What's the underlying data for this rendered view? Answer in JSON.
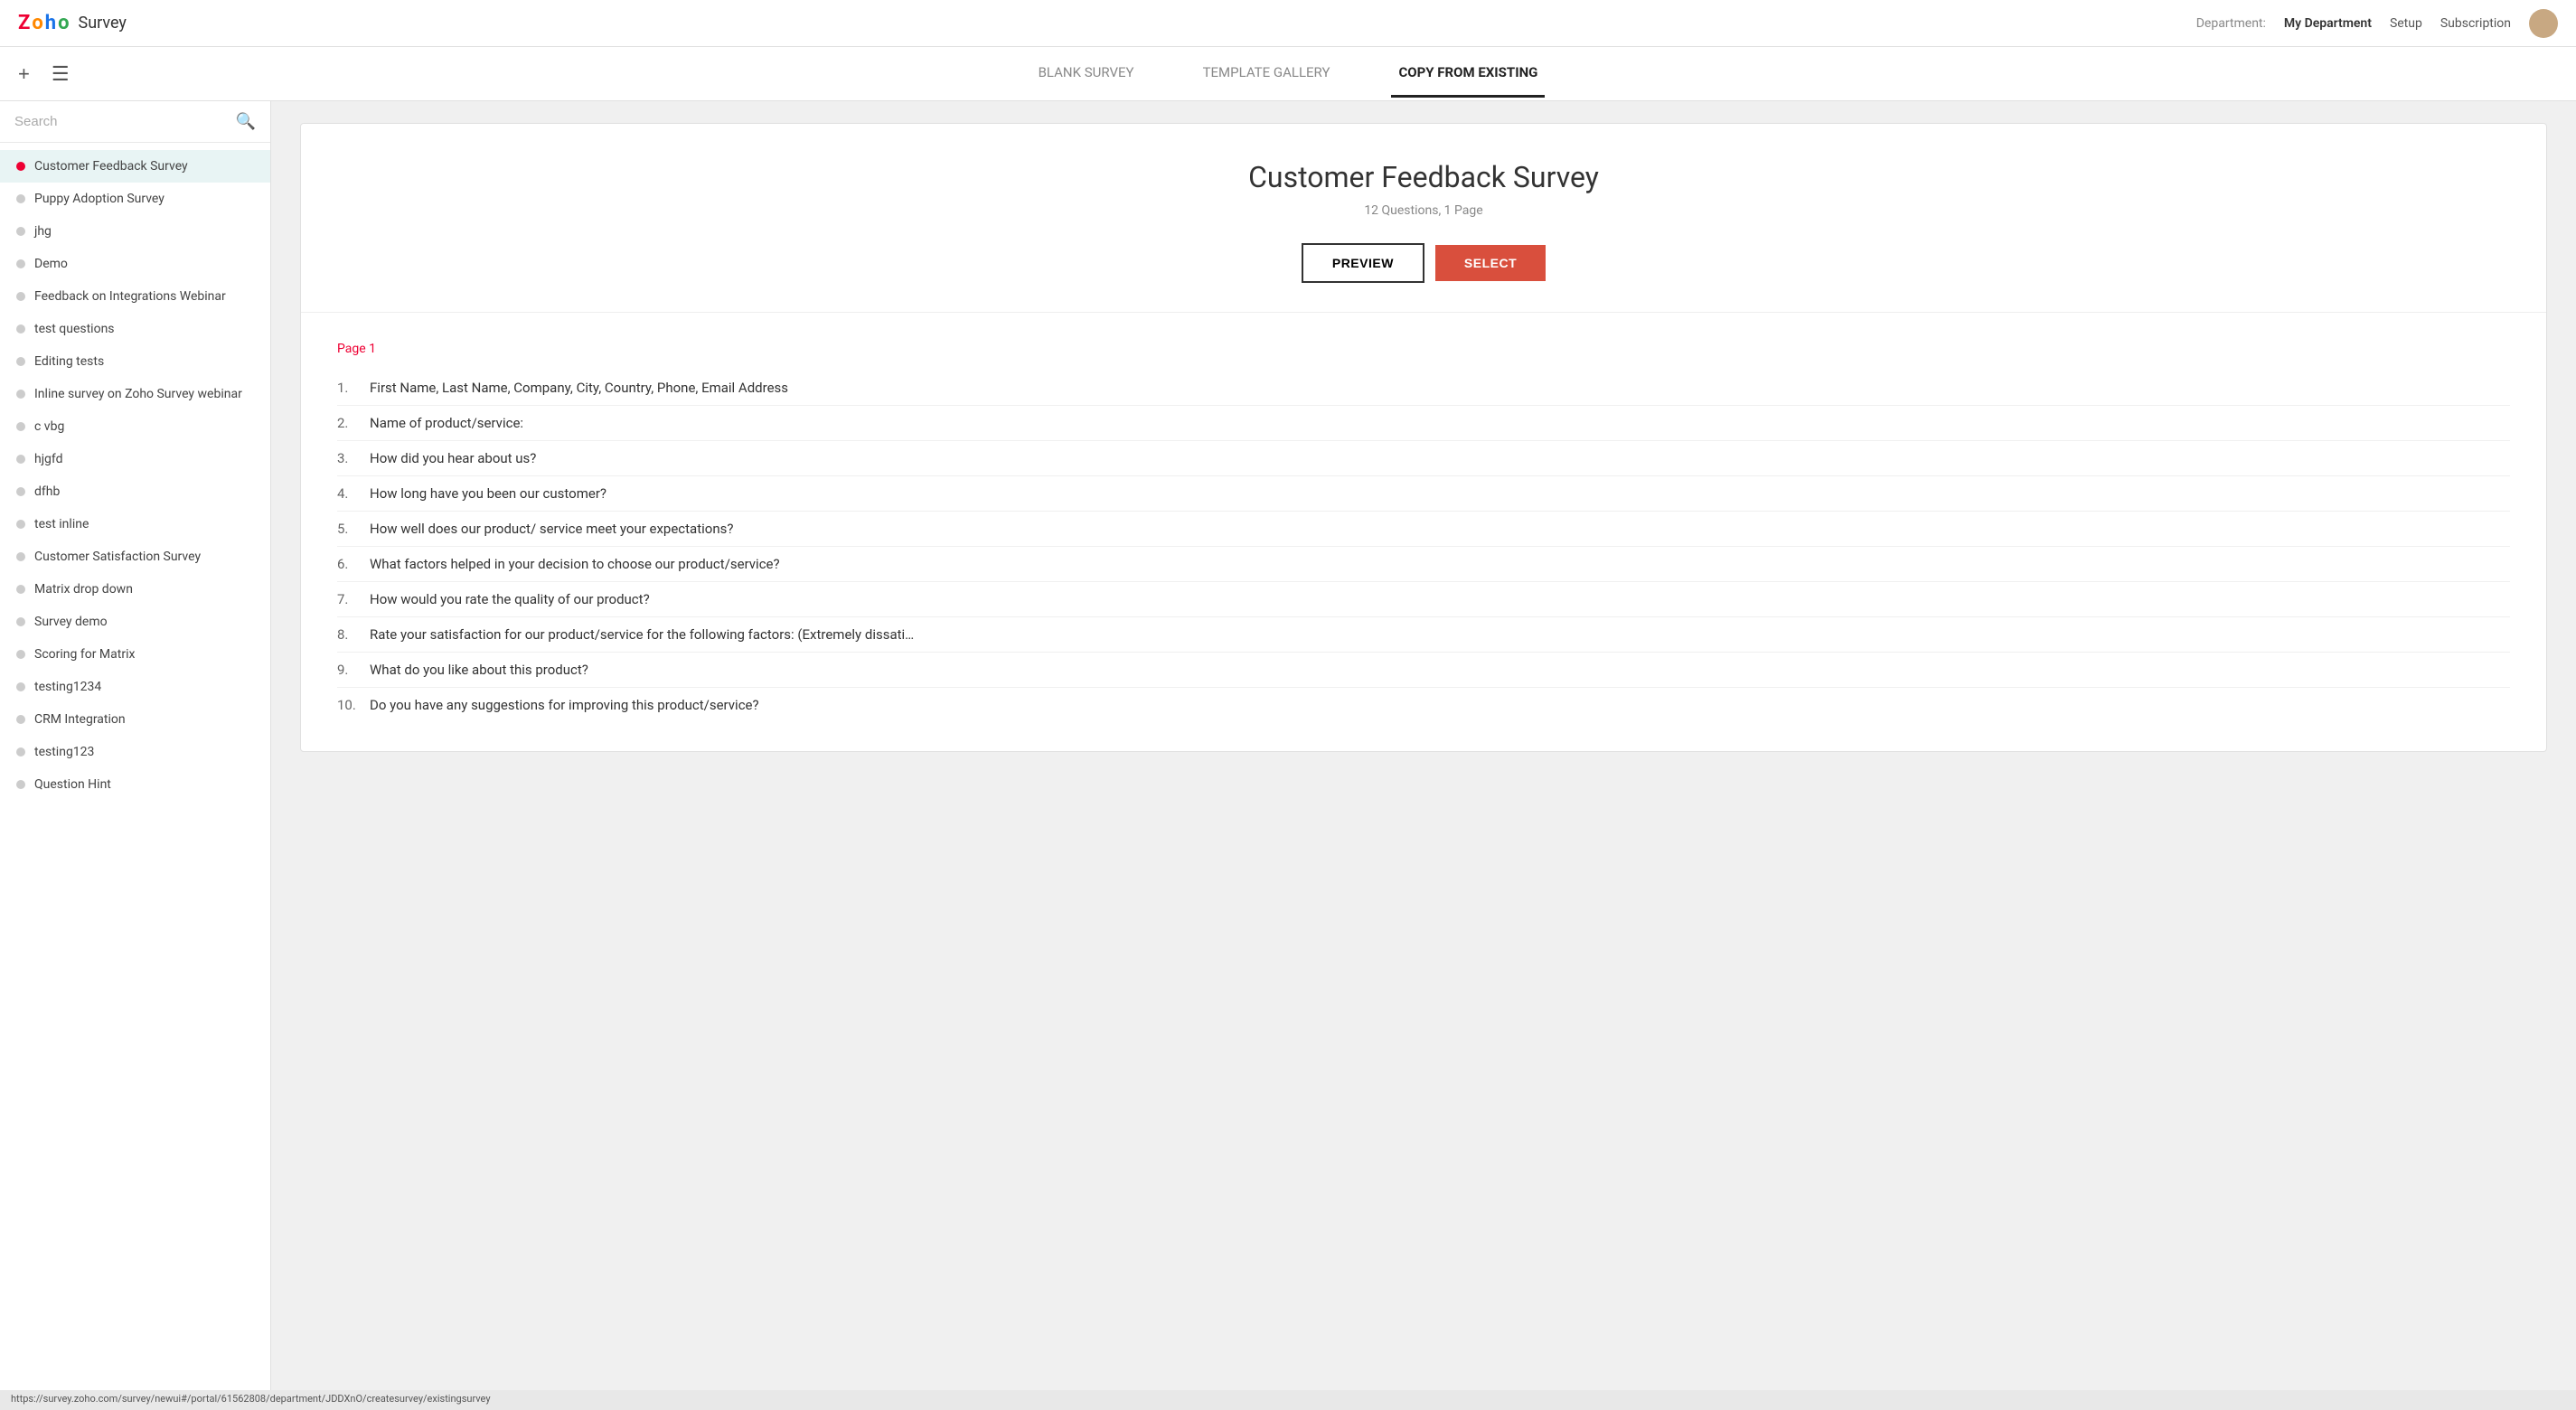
{
  "app": {
    "logo_z": "Z",
    "logo_o": "o",
    "logo_h": "h",
    "logo_o2": "o",
    "logo_name": "Survey"
  },
  "topnav": {
    "department_label": "Department:",
    "department_value": "My Department",
    "setup_label": "Setup",
    "subscription_label": "Subscription"
  },
  "toolbar": {
    "tabs": [
      {
        "id": "blank",
        "label": "BLANK SURVEY",
        "active": false
      },
      {
        "id": "template",
        "label": "TEMPLATE GALLERY",
        "active": false
      },
      {
        "id": "copy",
        "label": "COPY FROM EXISTING",
        "active": true
      }
    ]
  },
  "search": {
    "placeholder": "Search"
  },
  "surveys": [
    {
      "id": "customer-feedback",
      "label": "Customer Feedback Survey",
      "active": true
    },
    {
      "id": "puppy-adoption",
      "label": "Puppy Adoption Survey",
      "active": false
    },
    {
      "id": "jhg",
      "label": "jhg",
      "active": false
    },
    {
      "id": "demo",
      "label": "Demo",
      "active": false
    },
    {
      "id": "feedback-webinar",
      "label": "Feedback on Integrations Webinar",
      "active": false
    },
    {
      "id": "test-questions",
      "label": "test questions",
      "active": false
    },
    {
      "id": "editing-tests",
      "label": "Editing tests",
      "active": false
    },
    {
      "id": "inline-survey",
      "label": "Inline survey on Zoho Survey webinar",
      "active": false
    },
    {
      "id": "cvbg",
      "label": "c vbg",
      "active": false
    },
    {
      "id": "hjgfd",
      "label": "hjgfd",
      "active": false
    },
    {
      "id": "dfhb",
      "label": "dfhb",
      "active": false
    },
    {
      "id": "test-inline",
      "label": "test inline",
      "active": false
    },
    {
      "id": "customer-satisfaction",
      "label": "Customer Satisfaction Survey",
      "active": false
    },
    {
      "id": "matrix-dropdown",
      "label": "Matrix drop down",
      "active": false
    },
    {
      "id": "survey-demo",
      "label": "Survey demo",
      "active": false
    },
    {
      "id": "scoring-matrix",
      "label": "Scoring for Matrix",
      "active": false
    },
    {
      "id": "testing1234",
      "label": "testing1234",
      "active": false
    },
    {
      "id": "crm-integration",
      "label": "CRM Integration",
      "active": false
    },
    {
      "id": "testing123",
      "label": "testing123",
      "active": false
    },
    {
      "id": "question-hint",
      "label": "Question Hint",
      "active": false
    }
  ],
  "selected_survey": {
    "title": "Customer Feedback Survey",
    "meta": "12 Questions, 1 Page",
    "preview_label": "PREVIEW",
    "select_label": "SELECT",
    "page_label": "Page 1",
    "questions": [
      "First Name, Last Name, Company, City, Country, Phone, Email Address",
      "Name of product/service:",
      "How did you hear about us?",
      "How long have you been our customer?",
      "How well does our product/ service meet your expectations?",
      "What factors helped in your decision to choose our product/service?",
      "How would you rate the quality of our product?",
      "Rate your satisfaction for our product/service for the following factors: (Extremely dissati…",
      "What do you like about this product?",
      "Do you have any suggestions for improving this product/service?"
    ]
  },
  "status_bar": {
    "url": "https://survey.zoho.com/survey/newui#/portal/61562808/department/JDDXnO/createsurvey/existingsurvey"
  }
}
